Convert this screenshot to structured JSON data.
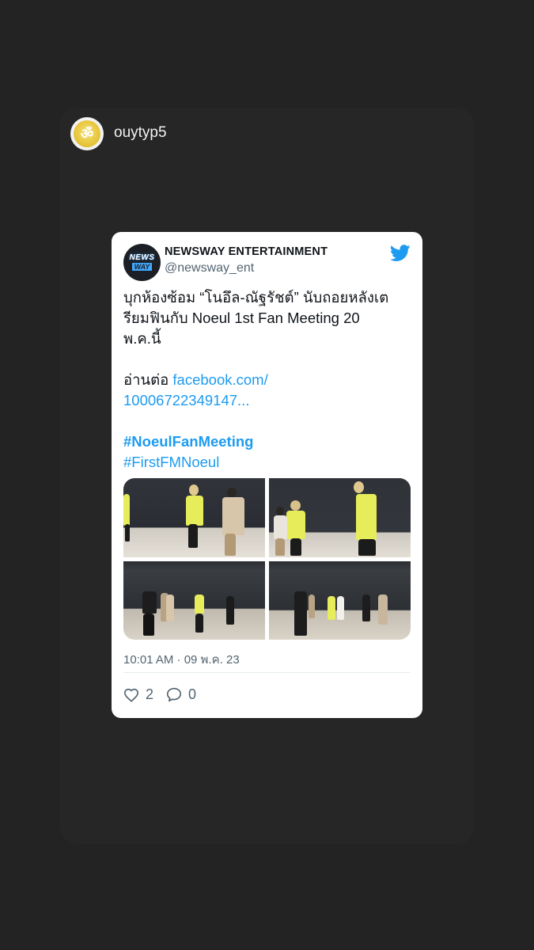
{
  "story": {
    "username": "ouytyp5",
    "avatar_symbol": "ॐ"
  },
  "tweet": {
    "author_name": "NEWSWAY ENTERTAINMENT",
    "author_handle": "@newsway_ent",
    "avatar_logo_top": "NEWS",
    "avatar_logo_bottom": "WAY",
    "body_lines": [
      "บุกห้องซ้อม “โนอึล-ณัฐรัชต์” นับถอยหลังเต",
      "รียมฟินกับ Noeul 1st Fan Meeting 20",
      "พ.ค.นี้"
    ],
    "read_more_prefix": " อ่านต่อ ",
    "link_line1": "facebook.com/",
    "link_line2": "10006722349147...",
    "hashtag1": "#NoeulFanMeeting",
    "hashtag2": "#FirstFMNoeul",
    "timestamp": "10:01 AM · 09 พ.ค. 23",
    "likes": "2",
    "replies": "0"
  },
  "colors": {
    "background": "#232323",
    "card": "#262626",
    "twitter_blue": "#1d9bf0",
    "shirt_yellow": "#e6ec5a"
  },
  "icons": [
    "twitter-bird-icon",
    "heart-icon",
    "reply-bubble-icon",
    "om-avatar-icon"
  ]
}
